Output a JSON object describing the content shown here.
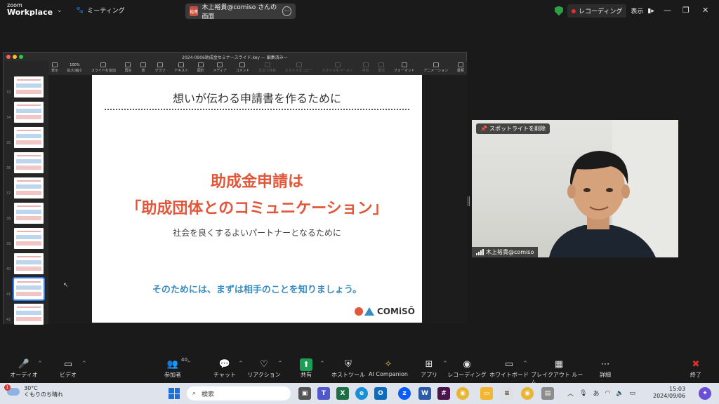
{
  "zoom": {
    "brand_line1": "zoom",
    "brand_line2": "Workplace",
    "meeting_label": "ミーティング",
    "share_pill": {
      "avatar": "裕貴",
      "label": "木上裕貴@comiso さんの画面"
    },
    "recording_label": "レコーディング",
    "view_label": "表示",
    "spotlight_label": "スポットライトを削除",
    "participant_name": "木上裕貴@comiso",
    "participant_count": "40",
    "toolbar": [
      {
        "label": "オーディオ",
        "icon": "mic-muted-icon"
      },
      {
        "label": "ビデオ",
        "icon": "video-icon"
      },
      {
        "label": "参加者",
        "icon": "participants-icon"
      },
      {
        "label": "チャット",
        "icon": "chat-icon"
      },
      {
        "label": "リアクション",
        "icon": "heart-icon"
      },
      {
        "label": "共有",
        "icon": "share-icon"
      },
      {
        "label": "ホストツール",
        "icon": "shield-icon"
      },
      {
        "label": "AI Companion",
        "icon": "sparkle-icon"
      },
      {
        "label": "アプリ",
        "icon": "apps-icon"
      },
      {
        "label": "レコーディング",
        "icon": "record-icon"
      },
      {
        "label": "ホワイトボード",
        "icon": "whiteboard-icon"
      },
      {
        "label": "ブレイクアウト ルーム",
        "icon": "grid-icon"
      },
      {
        "label": "詳細",
        "icon": "more-icon"
      },
      {
        "label": "終了",
        "icon": "close-icon"
      }
    ]
  },
  "keynote": {
    "window_title": "2024-0906助成金セミナースライド.key — 編集済みー",
    "toolbar": [
      {
        "label": "表示",
        "dim": false
      },
      {
        "label": "拡大/縮小",
        "dim": false,
        "value": "100%"
      },
      {
        "label": "スライドを追加",
        "dim": false
      },
      {
        "label": "再生",
        "dim": false
      },
      {
        "label": "表",
        "dim": false
      },
      {
        "label": "グラフ",
        "dim": false
      },
      {
        "label": "テキスト",
        "dim": false
      },
      {
        "label": "図形",
        "dim": false
      },
      {
        "label": "メディア",
        "dim": false
      },
      {
        "label": "コメント",
        "dim": false
      },
      {
        "label": "本文で共有",
        "dim": true
      },
      {
        "label": "スタイルをコピー",
        "dim": true
      },
      {
        "label": "スタイルをペースト",
        "dim": true
      },
      {
        "label": "共有",
        "dim": true
      },
      {
        "label": "書式",
        "dim": true
      },
      {
        "label": "フォーマット",
        "dim": false
      },
      {
        "label": "アニメーション",
        "dim": false
      },
      {
        "label": "書類",
        "dim": false
      }
    ],
    "slide_numbers": [
      "33",
      "34",
      "35",
      "36",
      "37",
      "38",
      "39",
      "40",
      "41",
      "42"
    ],
    "selected_slide": "41",
    "slide": {
      "heading": "想いが伝わる申請書を作るために",
      "main_line1": "助成金申請は",
      "main_line2": "「助成団体とのコミュニケーション」",
      "subtitle": "社会を良くするよいパートナーとなるために",
      "footer": "そのためには、まずは相手のことを知りましょう。",
      "logo": "COMiSŌ"
    }
  },
  "taskbar": {
    "weather_temp": "30°C",
    "weather_desc": "くもりのち晴れ",
    "weather_badge": "1",
    "search_placeholder": "検索",
    "ime": "あ",
    "time": "15:03",
    "date": "2024/09/06"
  },
  "colors": {
    "slide_accent": "#e0573a",
    "slide_blue": "#3a8cc0",
    "zoom_bg": "#1a1a1a",
    "recording_red": "#e0302a"
  }
}
